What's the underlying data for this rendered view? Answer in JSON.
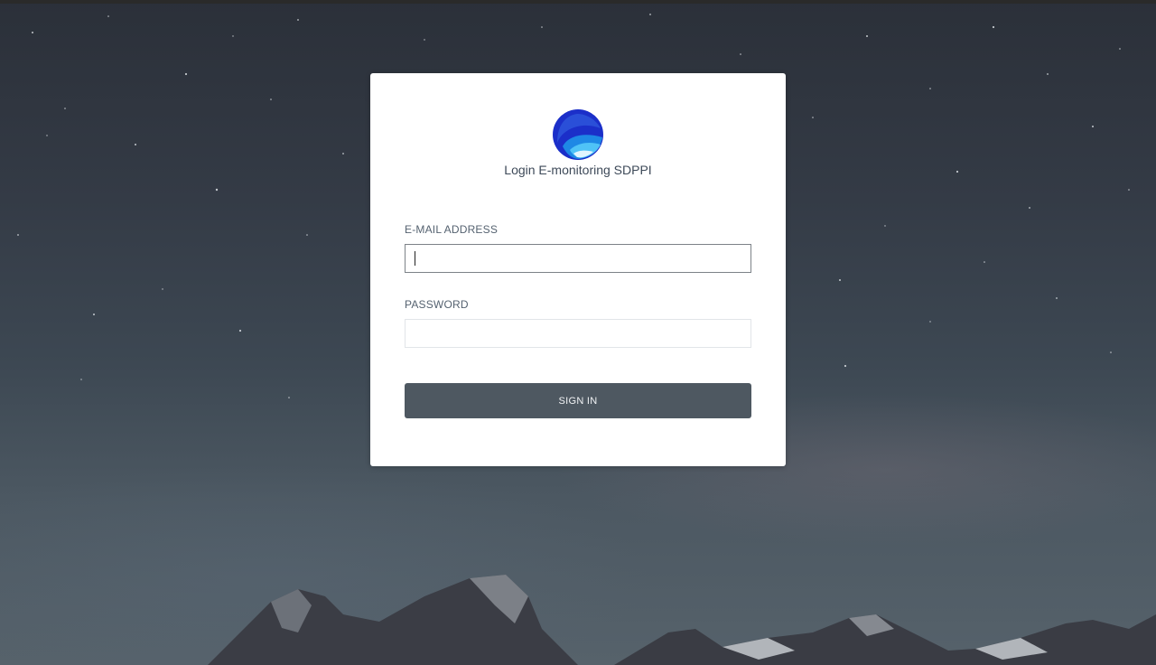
{
  "login": {
    "title": "Login E-monitoring SDPPI",
    "email_label": "E-MAIL ADDRESS",
    "email_value": "",
    "password_label": "PASSWORD",
    "password_value": "",
    "signin_label": "SIGN IN"
  },
  "logo": {
    "icon": "kominfo-globe-wave-logo",
    "colors": [
      "#1b2fc9",
      "#1e88e5",
      "#4fc3f7"
    ]
  },
  "colors": {
    "button": "#4e5861",
    "card": "#ffffff",
    "title_text": "#3e4a59"
  }
}
